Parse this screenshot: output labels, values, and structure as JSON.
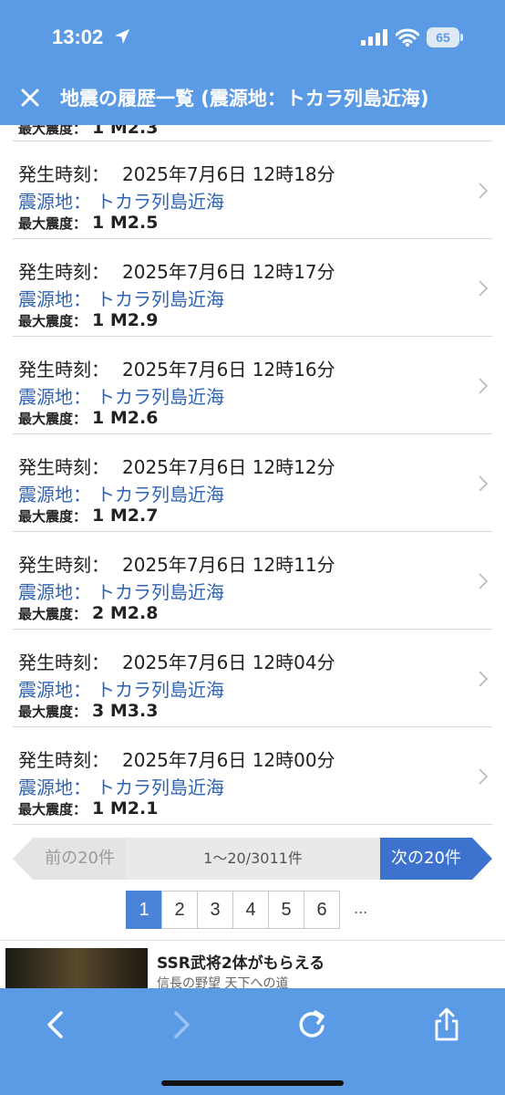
{
  "status_bar": {
    "time": "13:02",
    "battery": "65"
  },
  "header": {
    "title": "地震の履歴一覧 (震源地：トカラ列島近海)"
  },
  "labels": {
    "time": "発生時刻：",
    "epicenter": "震源地：",
    "intensity": "最大震度："
  },
  "partial_row": {
    "intensity": "1 M2.3"
  },
  "rows": [
    {
      "time": "2025年7月6日 12時18分",
      "epicenter": "トカラ列島近海",
      "intensity": "1 M2.5"
    },
    {
      "time": "2025年7月6日 12時17分",
      "epicenter": "トカラ列島近海",
      "intensity": "1 M2.9"
    },
    {
      "time": "2025年7月6日 12時16分",
      "epicenter": "トカラ列島近海",
      "intensity": "1 M2.6"
    },
    {
      "time": "2025年7月6日 12時12分",
      "epicenter": "トカラ列島近海",
      "intensity": "1 M2.7"
    },
    {
      "time": "2025年7月6日 12時11分",
      "epicenter": "トカラ列島近海",
      "intensity": "2 M2.8"
    },
    {
      "time": "2025年7月6日 12時04分",
      "epicenter": "トカラ列島近海",
      "intensity": "3 M3.3"
    },
    {
      "time": "2025年7月6日 12時00分",
      "epicenter": "トカラ列島近海",
      "intensity": "1 M2.1"
    }
  ],
  "pagination": {
    "prev_label": "前の20件",
    "range": "1〜20/3011件",
    "next_label": "次の20件",
    "pages": [
      "1",
      "2",
      "3",
      "4",
      "5",
      "6"
    ],
    "current": "1",
    "ellipsis": "..."
  },
  "ad": {
    "title": "SSR武将2体がもらえる",
    "subtitle": "信長の野望 天下への道"
  },
  "colors": {
    "header_bg": "#5b9be6",
    "link": "#2f63b4",
    "active_page": "#4a82d6",
    "next_button": "#3d72cf"
  },
  "icons": [
    "close-icon",
    "location-arrow-icon",
    "signal-icon",
    "wifi-icon",
    "battery-icon",
    "chevron-right-icon",
    "back-arrow-icon",
    "forward-arrow-icon",
    "reload-icon",
    "share-icon"
  ]
}
